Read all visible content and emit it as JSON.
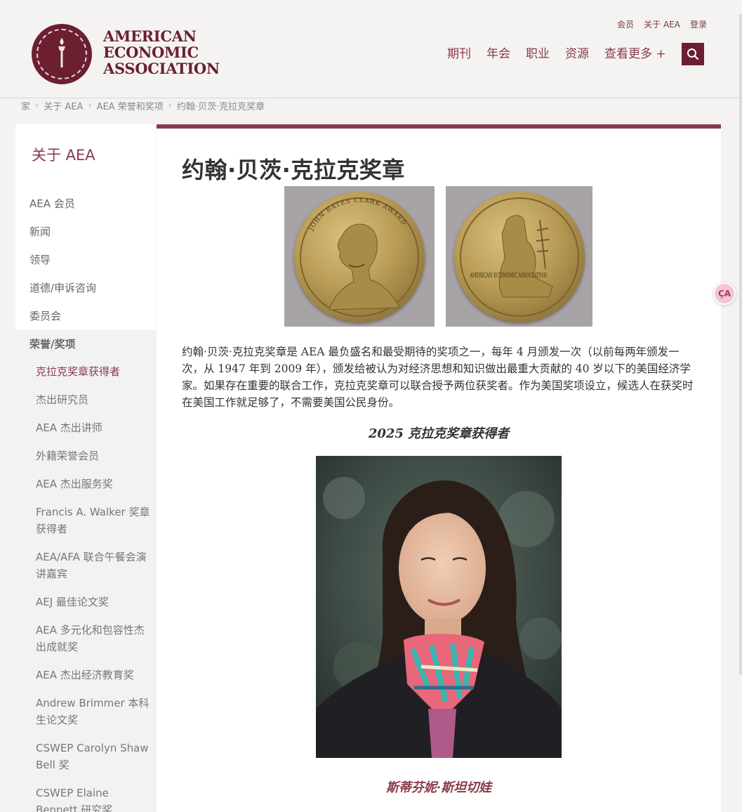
{
  "header": {
    "logo_lines": [
      "AMERICAN",
      "ECONOMIC",
      "ASSOCIATION"
    ],
    "utility_nav": [
      "会员",
      "关于 AEA",
      "登录"
    ],
    "main_nav": [
      "期刊",
      "年会",
      "职业",
      "资源",
      "查看更多 +"
    ]
  },
  "breadcrumb": [
    "家",
    "关于 AEA",
    "AEA 荣誉和奖项",
    "约翰·贝茨·克拉克奖章"
  ],
  "sidebar": {
    "title": "关于 AEA",
    "items": [
      "AEA 会员",
      "新闻",
      "领导",
      "道德/申诉咨询",
      "委员会"
    ],
    "section": "荣誉/奖项",
    "subitems": [
      "克拉克奖章获得者",
      "杰出研究员",
      "AEA 杰出讲师",
      "外籍荣誉会员",
      "AEA 杰出服务奖",
      "Francis A. Walker 奖章获得者",
      "AEA/AFA 联合午餐会演讲嘉宾",
      "AEJ 最佳论文奖",
      "AEA 多元化和包容性杰出成就奖",
      "AEA 杰出经济教育奖",
      "Andrew Brimmer 本科生论文奖",
      "CSWEP Carolyn Shaw Bell 奖",
      "CSWEP Elaine Bennett 研究奖"
    ]
  },
  "content": {
    "title": "约翰·贝茨·克拉克奖章",
    "medal_front_text": "JOHN BATES CLARK AWARD",
    "medal_back_text": "AMERICAN ECONOMIC ASSOCIATION",
    "body": "约翰·贝茨·克拉克奖章是 AEA 最负盛名和最受期待的奖项之一，每年 4 月颁发一次（以前每两年颁发一次，从 1947 年到 2009 年），颁发给被认为对经济思想和知识做出最重大贡献的 40 岁以下的美国经济学家。如果存在重要的联合工作，克拉克奖章可以联合授予两位获奖者。作为美国奖项设立，候选人在获奖时在美国工作就足够了，不需要美国公民身份。",
    "winner_heading": "2025 克拉克奖章获得者",
    "winner_name": "斯蒂芬妮·斯坦切娃"
  },
  "translate_button": "ÇA"
}
